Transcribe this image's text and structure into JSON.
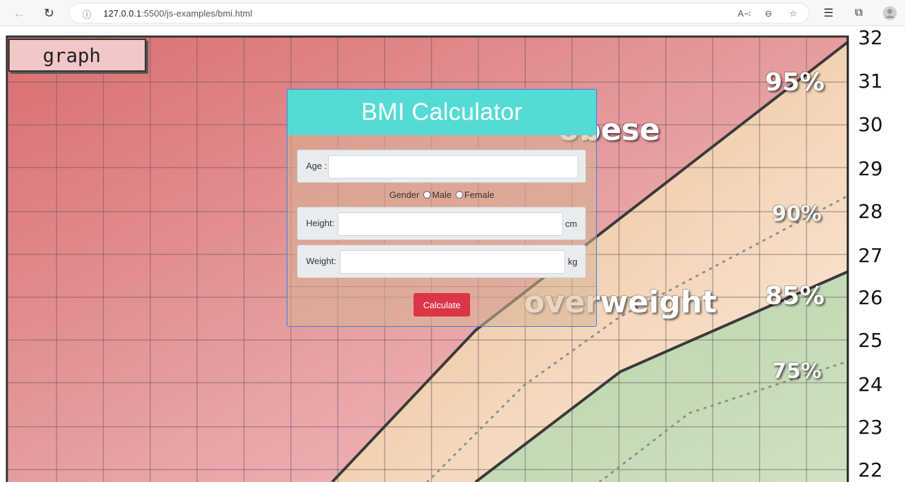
{
  "browser": {
    "url_host": "127.0.0.1",
    "url_path": ":5500/js-examples/bmi.html",
    "icons": [
      "back-arrow-icon",
      "refresh-icon",
      "info-icon",
      "read-aloud-icon",
      "zoom-out-icon",
      "add-favorite-icon",
      "favorites-icon",
      "collections-icon",
      "profile-icon"
    ]
  },
  "background": {
    "tab_label": "graph",
    "y_axis_ticks": [
      "32",
      "31",
      "30",
      "29",
      "28",
      "27",
      "26",
      "25",
      "24",
      "23",
      "22"
    ],
    "zone_labels": {
      "obese": "obese",
      "overweight": "overweight"
    },
    "percentile_labels": [
      "95%",
      "90%",
      "85%",
      "75%"
    ]
  },
  "card": {
    "title": "BMI Calculator",
    "age_label": "Age :",
    "age_value": "",
    "gender_label": "Gender",
    "gender_options": [
      "Male",
      "Female"
    ],
    "height_label": "Height:",
    "height_value": "",
    "height_unit": "cm",
    "weight_label": "Weight:",
    "weight_value": "",
    "weight_unit": "kg",
    "calculate_label": "Calculate"
  },
  "colors": {
    "header": "#55dbd5",
    "button": "#dc3545",
    "card_border": "#3a7cf0"
  }
}
